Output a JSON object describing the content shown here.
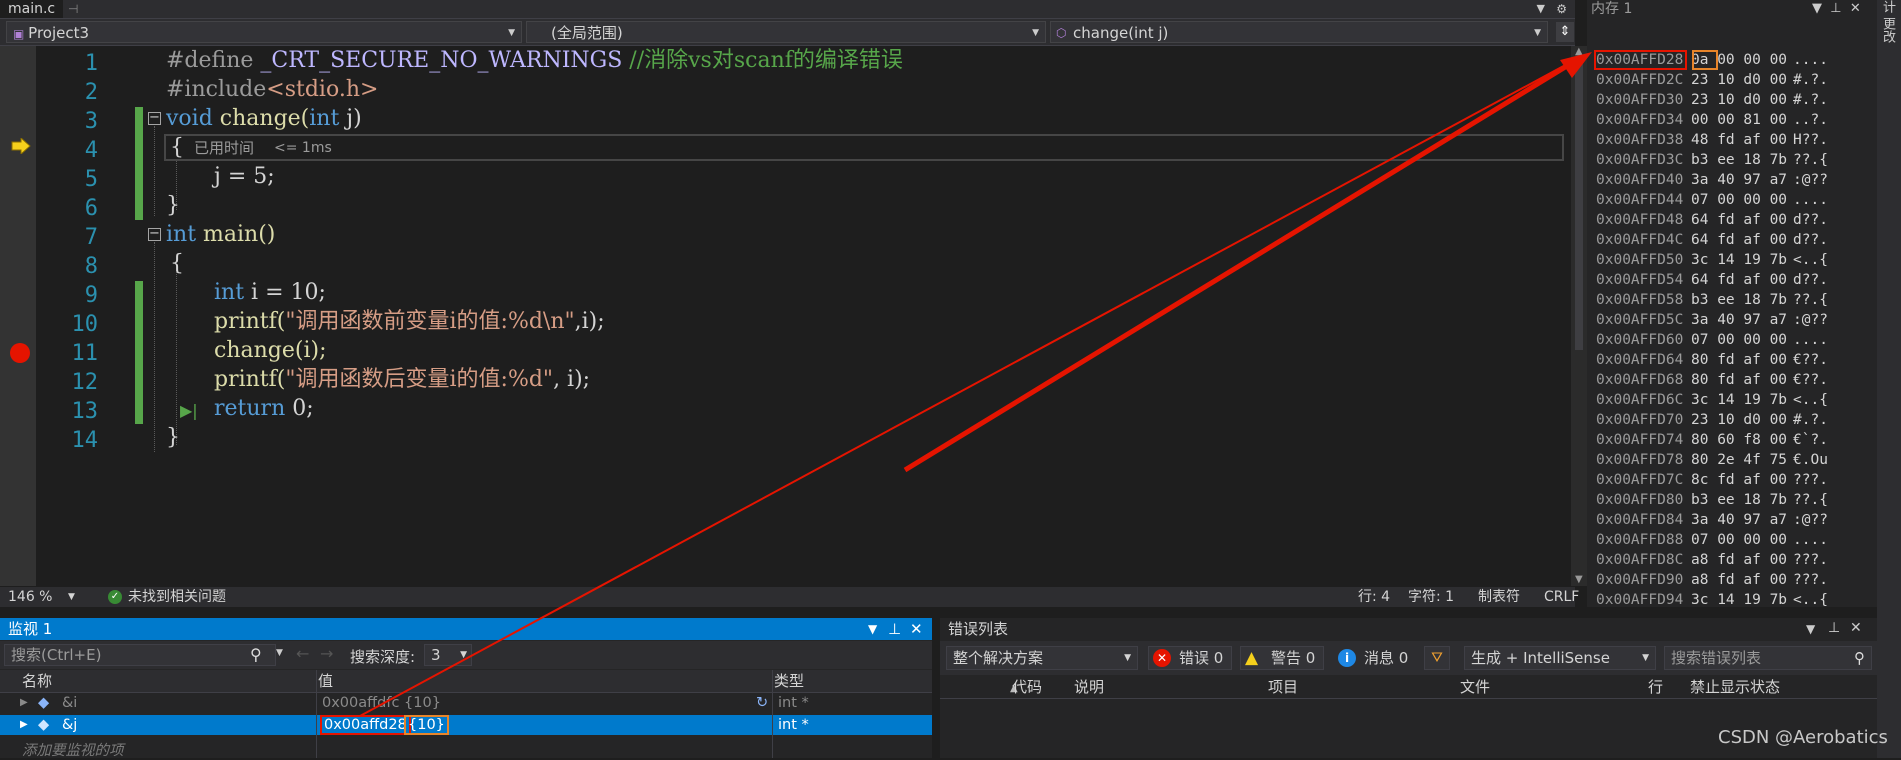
{
  "tabs": {
    "active": "main.c",
    "close": "⊣"
  },
  "navbar": {
    "project": "Project3",
    "scope": "(全局范围)",
    "function": "change(int j)"
  },
  "editor": {
    "line_numbers": [
      "1",
      "2",
      "3",
      "4",
      "5",
      "6",
      "7",
      "8",
      "9",
      "10",
      "11",
      "12",
      "13",
      "14"
    ],
    "lines": {
      "l1a": "#define ",
      "l1b": "_CRT_SECURE_NO_WARNINGS",
      "l1c": " //消除vs对scanf的编译错误",
      "l2a": "#include",
      "l2b": "<stdio.h>",
      "l3a": "void",
      "l3b": " change(",
      "l3c": "int",
      "l3d": " j)",
      "l4a": "{",
      "l5a": "j = 5;",
      "l6a": "}",
      "l7a": "int",
      "l7b": " main()",
      "l8a": "{",
      "l9a": "int",
      "l9b": " i = 10;",
      "l10a": "printf(",
      "l10b": "\"调用函数前变量i的值:%d\\n\"",
      "l10c": ",i);",
      "l11a": "change(i);",
      "l12a": "printf(",
      "l12b": "\"调用函数后变量i的值:%d\"",
      "l12c": ", i);",
      "l13a": "return",
      "l13b": " 0;",
      "l14a": "}"
    },
    "elapsed_label": "已用时间",
    "elapsed_value": "<= 1ms"
  },
  "status": {
    "zoom": "146 %",
    "issues": "未找到相关问题",
    "line": "行: 4",
    "char": "字符: 1",
    "tabs": "制表符",
    "eol": "CRLF"
  },
  "memory": {
    "title": "内存 1",
    "rows": [
      {
        "addr": "0x00AFFD28",
        "bytes": "0a 00 00 00",
        "chars": "...."
      },
      {
        "addr": "0x00AFFD2C",
        "bytes": "23 10 d0 00",
        "chars": "#.?."
      },
      {
        "addr": "0x00AFFD30",
        "bytes": "23 10 d0 00",
        "chars": "#.?."
      },
      {
        "addr": "0x00AFFD34",
        "bytes": "00 00 81 00",
        "chars": "..?."
      },
      {
        "addr": "0x00AFFD38",
        "bytes": "48 fd af 00",
        "chars": "H??."
      },
      {
        "addr": "0x00AFFD3C",
        "bytes": "b3 ee 18 7b",
        "chars": "??.{"
      },
      {
        "addr": "0x00AFFD40",
        "bytes": "3a 40 97 a7",
        "chars": ":@??"
      },
      {
        "addr": "0x00AFFD44",
        "bytes": "07 00 00 00",
        "chars": "...."
      },
      {
        "addr": "0x00AFFD48",
        "bytes": "64 fd af 00",
        "chars": "d??."
      },
      {
        "addr": "0x00AFFD4C",
        "bytes": "64 fd af 00",
        "chars": "d??."
      },
      {
        "addr": "0x00AFFD50",
        "bytes": "3c 14 19 7b",
        "chars": "<..{"
      },
      {
        "addr": "0x00AFFD54",
        "bytes": "64 fd af 00",
        "chars": "d??."
      },
      {
        "addr": "0x00AFFD58",
        "bytes": "b3 ee 18 7b",
        "chars": "??.{"
      },
      {
        "addr": "0x00AFFD5C",
        "bytes": "3a 40 97 a7",
        "chars": ":@??"
      },
      {
        "addr": "0x00AFFD60",
        "bytes": "07 00 00 00",
        "chars": "...."
      },
      {
        "addr": "0x00AFFD64",
        "bytes": "80 fd af 00",
        "chars": "€??."
      },
      {
        "addr": "0x00AFFD68",
        "bytes": "80 fd af 00",
        "chars": "€??."
      },
      {
        "addr": "0x00AFFD6C",
        "bytes": "3c 14 19 7b",
        "chars": "<..{"
      },
      {
        "addr": "0x00AFFD70",
        "bytes": "23 10 d0 00",
        "chars": "#.?."
      },
      {
        "addr": "0x00AFFD74",
        "bytes": "80 60 f8 00",
        "chars": "€`?."
      },
      {
        "addr": "0x00AFFD78",
        "bytes": "80 2e 4f 75",
        "chars": "€.Ou"
      },
      {
        "addr": "0x00AFFD7C",
        "bytes": "8c fd af 00",
        "chars": "???."
      },
      {
        "addr": "0x00AFFD80",
        "bytes": "b3 ee 18 7b",
        "chars": "??.{"
      },
      {
        "addr": "0x00AFFD84",
        "bytes": "3a 40 97 a7",
        "chars": ":@??"
      },
      {
        "addr": "0x00AFFD88",
        "bytes": "07 00 00 00",
        "chars": "...."
      },
      {
        "addr": "0x00AFFD8C",
        "bytes": "a8 fd af 00",
        "chars": "???."
      },
      {
        "addr": "0x00AFFD90",
        "bytes": "a8 fd af 00",
        "chars": "???."
      },
      {
        "addr": "0x00AFFD94",
        "bytes": "3c 14 19 7b",
        "chars": "<..{"
      }
    ],
    "side_text": "计 更改"
  },
  "watch": {
    "title": "监视 1",
    "search_placeholder": "搜索(Ctrl+E)",
    "depth_label": "搜索深度:",
    "depth_value": "3",
    "cols": {
      "name": "名称",
      "value": "值",
      "type": "类型"
    },
    "rows": [
      {
        "name": "&i",
        "value": "0x00affdfc {10}",
        "type": "int *"
      },
      {
        "name": "&j",
        "value_addr": "0x00affd28",
        "value_rest": "{10}",
        "type": "int *"
      }
    ],
    "add_hint": "添加要监视的项"
  },
  "errors": {
    "title": "错误列表",
    "scope": "整个解决方案",
    "err": "错误 0",
    "warn": "警告 0",
    "msg": "消息 0",
    "build": "生成 + IntelliSense",
    "search_placeholder": "搜索错误列表",
    "cols": {
      "code": "代码",
      "desc": "说明",
      "project": "项目",
      "file": "文件",
      "line": "行",
      "suppress": "禁止显示状态"
    }
  },
  "watermark": "CSDN @Aerobatics",
  "colors": {
    "highlight_red": "#e51400",
    "highlight_orange": "#e8852a",
    "accent": "#007acc"
  }
}
